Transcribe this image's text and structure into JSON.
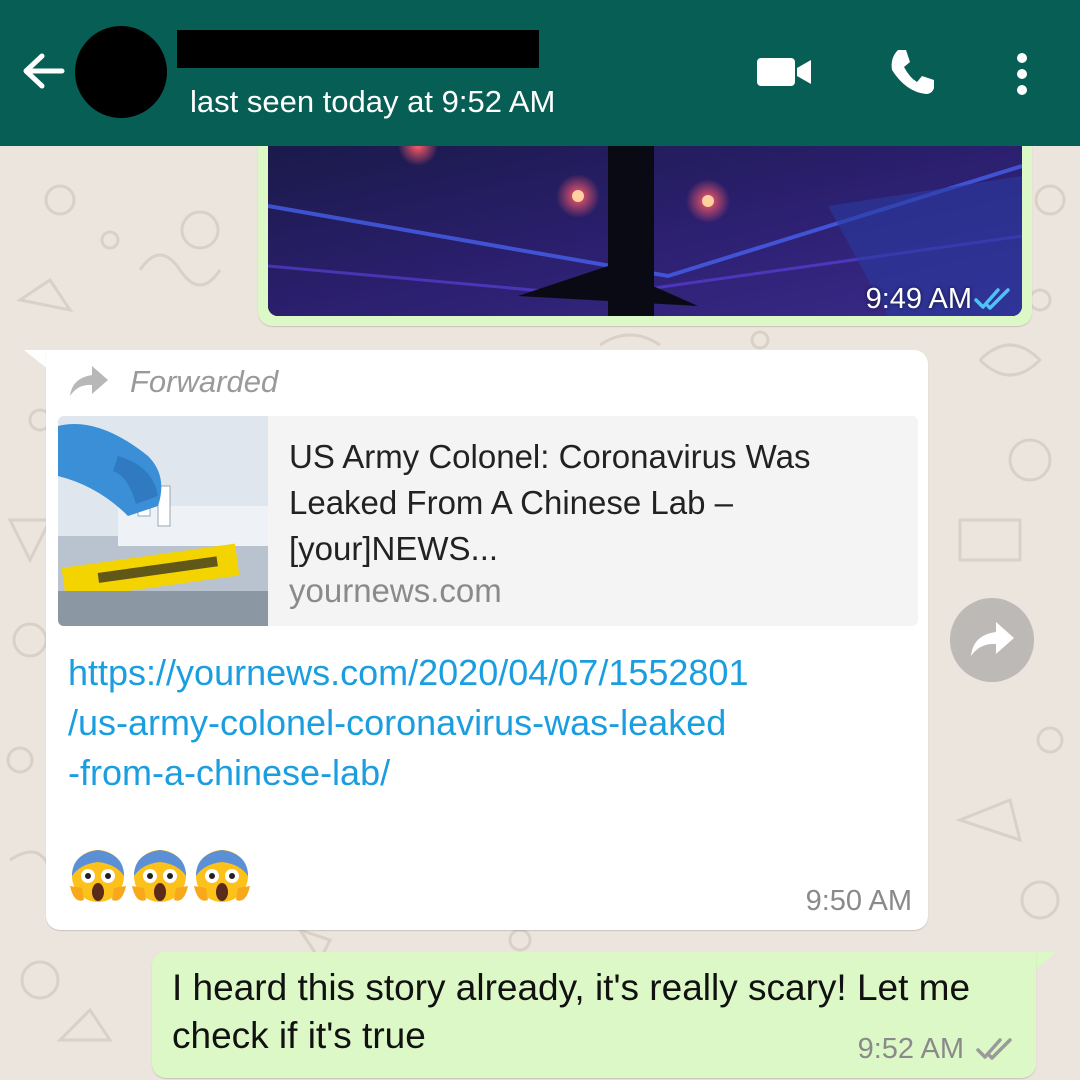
{
  "header": {
    "last_seen": "last seen today at 9:52 AM",
    "bg_color": "#075e54"
  },
  "messages": {
    "image": {
      "time": "9:49 AM",
      "status": "read-double-check"
    },
    "forwarded": {
      "forwarded_label": "Forwarded",
      "preview_title": "US Army Colonel: Coronavirus Was Leaked From A Chinese Lab – [your]NEWS...",
      "preview_domain": "yournews.com",
      "link": "https://yournews.com/2020/04/07/1552801/us-army-colonel-coronavirus-was-leaked-from-a-chinese-lab/",
      "emojis": [
        "😱",
        "😱",
        "😱"
      ],
      "time": "9:50 AM"
    },
    "reply": {
      "text": "I heard this story already, it's really scary! Let me check if it's true",
      "time": "9:52 AM",
      "status": "double-check"
    }
  },
  "icons": {
    "back": "arrow-left-icon",
    "video": "video-camera-icon",
    "call": "phone-icon",
    "menu": "more-vertical-icon",
    "forwarded": "forward-arrow-icon",
    "share": "share-arrow-icon"
  },
  "colors": {
    "outgoing_bubble": "#dcf8c6",
    "incoming_bubble": "#ffffff",
    "link": "#1a9ee0",
    "wallpaper": "#ece5dd"
  }
}
